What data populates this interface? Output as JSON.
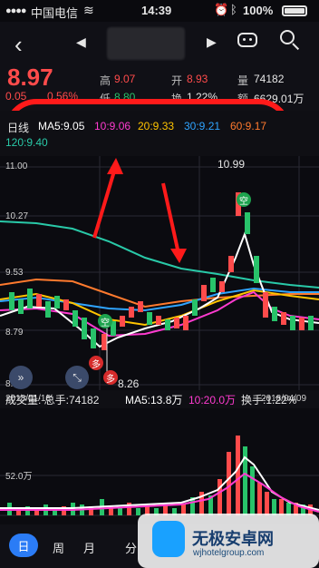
{
  "status_bar": {
    "carrier": "中国电信",
    "time": "14:39",
    "battery": "100%"
  },
  "nav": {
    "prev": "◀",
    "next": "▶"
  },
  "quote": {
    "price": "8.97",
    "change": "0.05",
    "change_pct": "0.56%",
    "high_label": "高",
    "high": "9.07",
    "open_label": "开",
    "open": "8.93",
    "vol_label": "量",
    "vol": "74182",
    "low_label": "低",
    "low": "8.80",
    "turnover_label": "换",
    "turnover": "1.22%",
    "amount_label": "额",
    "amount": "6629.01万"
  },
  "ma": {
    "type": "日线",
    "ma5": "MA5:9.05",
    "ma10": "10:9.06",
    "ma20": "20:9.33",
    "ma30": "30:9.21",
    "ma60": "60:9.17",
    "ma120": "120:9.40"
  },
  "chart": {
    "y_labels": [
      "11.00",
      "10.27",
      "9.53",
      "8.79",
      "8.06"
    ],
    "low_annotation": "8.26",
    "high_annotation": "10.99",
    "marker_kong": "空",
    "marker_duo": "多",
    "date_left": "2018/01/18",
    "date_right": "2018/04/09"
  },
  "volume": {
    "title": "成交量: 总手:74182",
    "ma5": "MA5:13.8万",
    "ma10": "10:20.0万",
    "turnover": "换手:1.22%",
    "y_label": "52.0万"
  },
  "tabs": {
    "day": "日",
    "week": "周",
    "month": "月",
    "minute": "分"
  },
  "watermark": {
    "title": "无极安卓网",
    "url": "wjhotelgroup.com"
  },
  "colors": {
    "red": "#ff4b4b",
    "green": "#28c36a",
    "pink": "#ff3bd0",
    "yellow": "#ffc400",
    "blue": "#2fa4ff",
    "orange": "#ff7a2e",
    "teal": "#29c9a8",
    "annotation": "#ff1a1a"
  }
}
